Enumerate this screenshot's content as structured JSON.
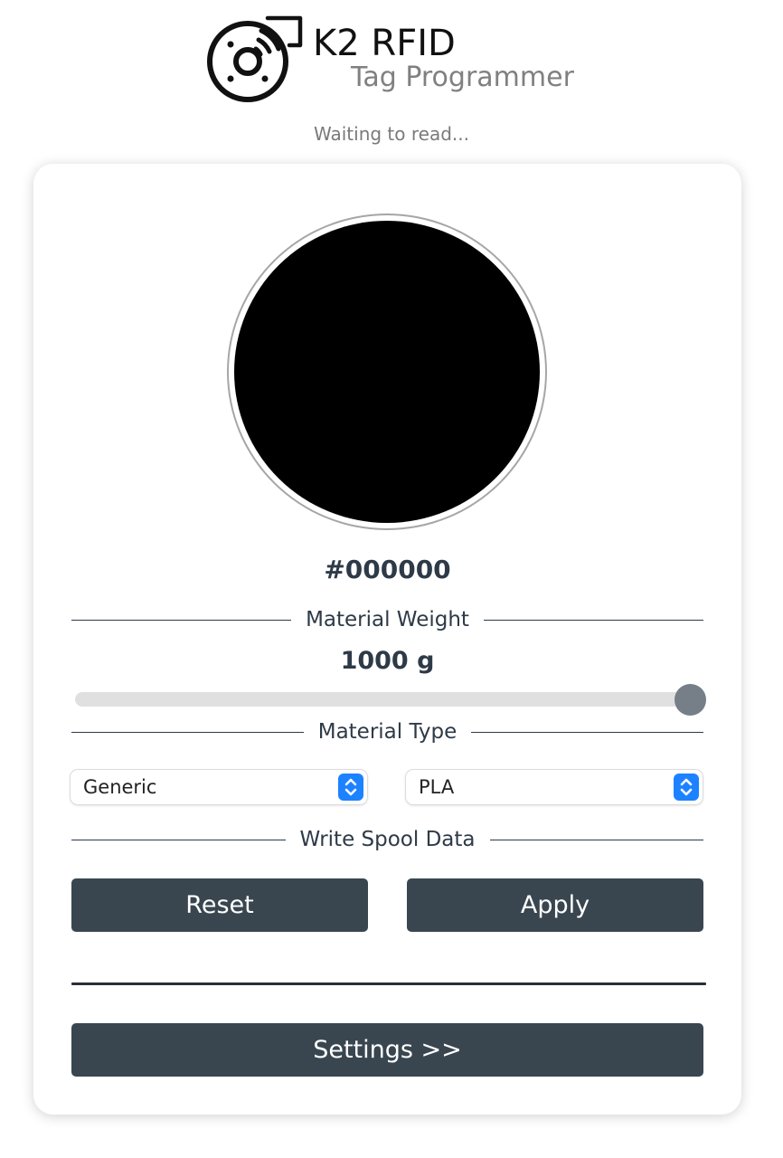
{
  "header": {
    "title": "K2 RFID",
    "subtitle": "Tag Programmer",
    "logo_icon": "rfid-spool-icon"
  },
  "status": "Waiting to read...",
  "color": {
    "hex_label": "#000000",
    "swatch_color": "#000000"
  },
  "weight": {
    "section_label": "Material Weight",
    "value_label": "1000 g",
    "slider_fraction": 1.0
  },
  "material": {
    "section_label": "Material Type",
    "brand_value": "Generic",
    "type_value": "PLA"
  },
  "write": {
    "section_label": "Write Spool Data",
    "reset_label": "Reset",
    "apply_label": "Apply"
  },
  "settings_label": "Settings >>",
  "colors": {
    "button_bg": "#394650",
    "select_accent": "#1d82ff",
    "slider_thumb": "#767e87"
  }
}
